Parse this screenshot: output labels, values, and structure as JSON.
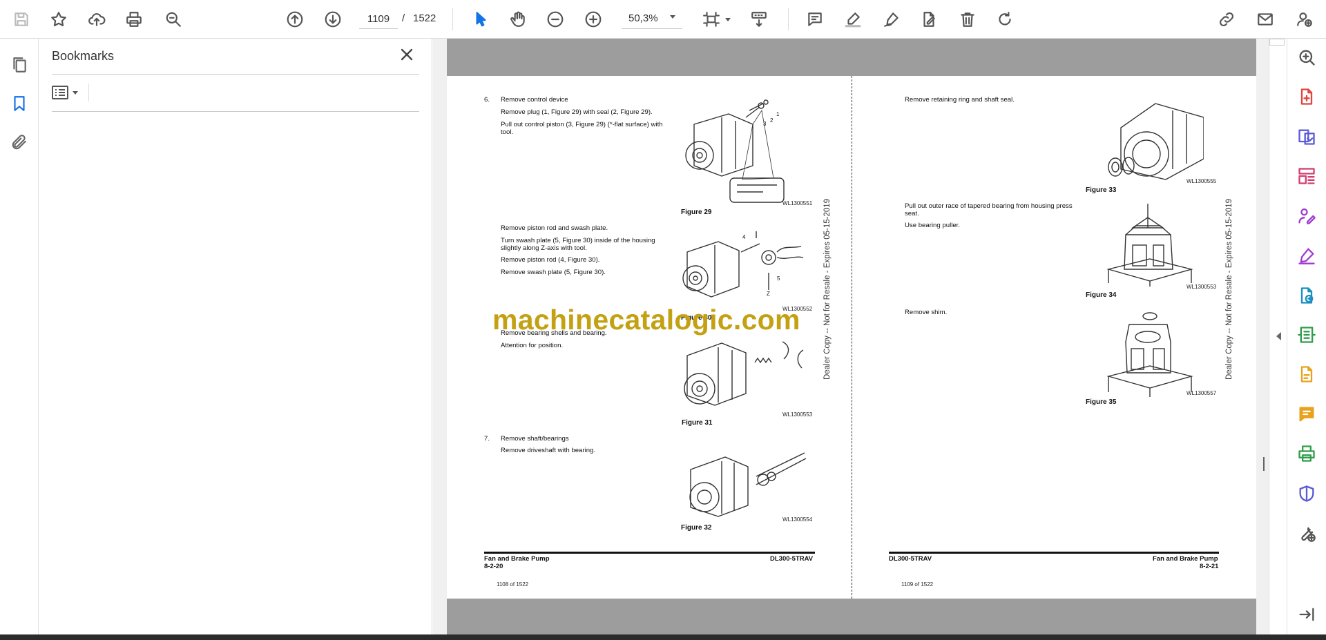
{
  "toolbar": {
    "current_page": "1109",
    "page_separator": "/",
    "total_pages": "1522",
    "zoom": "50,3%"
  },
  "bookmarks": {
    "title": "Bookmarks"
  },
  "document": {
    "watermark": "machinecatalogic.com",
    "left_page": {
      "step6_num": "6.",
      "step6_title": "Remove control device",
      "step6_l1": "Remove plug (1, Figure 29) with seal (2, Figure 29).",
      "step6_l2a": "Pull out control piston (3, Figure 29) (*-flat surface) with",
      "step6_l2b": "tool.",
      "fig29_caption": "Figure 29",
      "fig29_code": "WL1300551",
      "fig29_label_1": "1",
      "fig29_label_2": "2",
      "fig29_label_3": "3",
      "rod_l1": "Remove piston rod and swash plate.",
      "rod_l2a": "Turn swash plate (5, Figure 30) inside of the housing",
      "rod_l2b": "slightly along Z-axis with tool.",
      "rod_l3": "Remove piston rod (4, Figure 30).",
      "rod_l4": "Remove swash plate (5, Figure 30).",
      "fig30_caption": "Figure 30",
      "fig30_code": "WL1300552",
      "fig30_label_4": "4",
      "fig30_label_5": "5",
      "fig30_label_z": "Z",
      "bear_l1": "Remove bearing shells and bearing.",
      "bear_l2": "Attention for position.",
      "fig31_caption": "Figure 31",
      "fig31_code": "WL1300553",
      "step7_num": "7.",
      "step7_title": "Remove shaft/bearings",
      "step7_l1": "Remove driveshaft with bearing.",
      "fig32_caption": "Figure 32",
      "fig32_code": "WL1300554",
      "footer_left_1": "Fan and Brake Pump",
      "footer_left_2": "8-2-20",
      "footer_right": "DL300-5TRAV",
      "page_number": "1108 of 1522",
      "vertical_stamp": "Dealer Copy -- Not for Resale - Expires 05-15-2019"
    },
    "right_page": {
      "ret_l1": "Remove retaining ring and shaft seal.",
      "fig33_caption": "Figure 33",
      "fig33_code": "WL1300555",
      "race_l1a": "Pull out outer race of tapered bearing from housing press",
      "race_l1b": "seat.",
      "race_l2": "Use bearing puller.",
      "fig34_caption": "Figure 34",
      "fig34_code": "WL1300553",
      "shim_l1": "Remove shim.",
      "fig35_caption": "Figure 35",
      "fig35_code": "WL1300557",
      "footer_left": "DL300-5TRAV",
      "footer_right_1": "Fan and Brake Pump",
      "footer_right_2": "8-2-21",
      "page_number": "1109 of 1522",
      "vertical_stamp": "Dealer Copy -- Not for Resale - Expires 05-15-2019"
    }
  }
}
